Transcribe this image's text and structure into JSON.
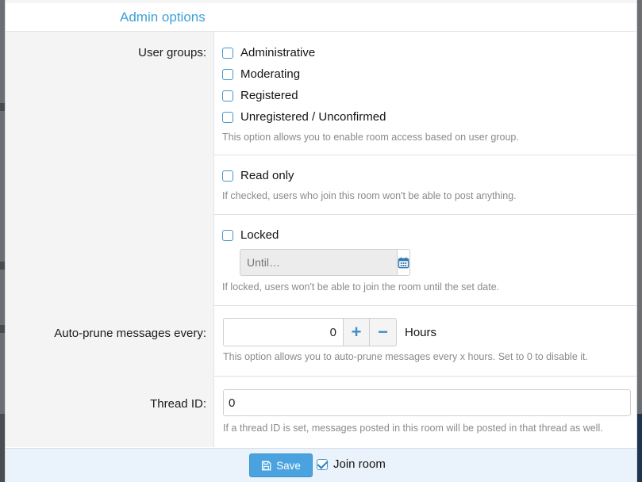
{
  "header": {
    "title": "Admin options"
  },
  "user_groups": {
    "label": "User groups:",
    "options": [
      {
        "label": "Administrative",
        "checked": false
      },
      {
        "label": "Moderating",
        "checked": false
      },
      {
        "label": "Registered",
        "checked": false
      },
      {
        "label": "Unregistered / Unconfirmed",
        "checked": false
      }
    ],
    "help": "This option allows you to enable room access based on user group."
  },
  "read_only": {
    "label": "Read only",
    "checked": false,
    "help": "If checked, users who join this room won't be able to post anything."
  },
  "locked": {
    "label": "Locked",
    "checked": false,
    "until_placeholder": "Until…",
    "help": "If locked, users won't be able to join the room until the set date.",
    "calendar_icon": "calendar-icon"
  },
  "auto_prune": {
    "label": "Auto-prune messages every:",
    "value": "0",
    "unit": "Hours",
    "plus_label": "+",
    "minus_label": "−",
    "help": "This option allows you to auto-prune messages every x hours. Set to 0 to disable it."
  },
  "thread": {
    "label": "Thread ID:",
    "value": "0",
    "help": "If a thread ID is set, messages posted in this room will be posted in that thread as well."
  },
  "footer": {
    "save_label": "Save",
    "join_label": "Join room",
    "join_checked": true
  },
  "colors": {
    "accent": "#3ea0d8",
    "primary_button": "#4aa3df",
    "footer_bg": "#eaf3fb"
  }
}
